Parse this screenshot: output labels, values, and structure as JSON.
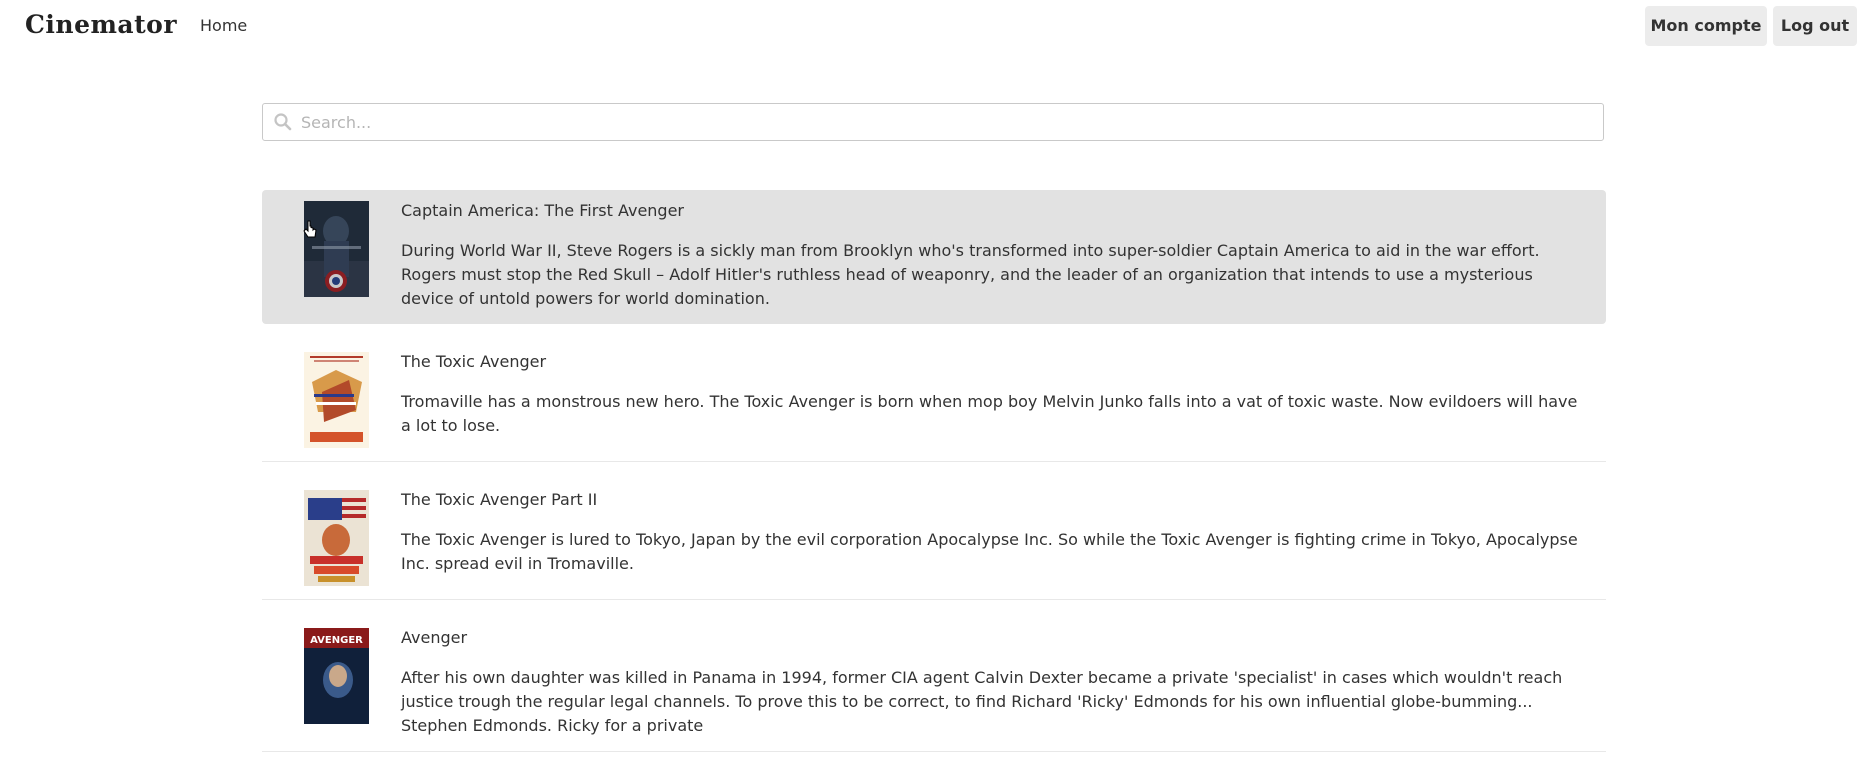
{
  "nav": {
    "brand": "Cinemator",
    "home": "Home",
    "account": "Mon compte",
    "logout": "Log out"
  },
  "search": {
    "placeholder": "Search...",
    "value": "",
    "icon": "search-icon"
  },
  "movies": [
    {
      "title": "Captain America: The First Avenger",
      "description": "During World War II, Steve Rogers is a sickly man from Brooklyn who's transformed into super-soldier Captain America to aid in the war effort. Rogers must stop the Red Skull – Adolf Hitler's ruthless head of weaponry, and the leader of an organization that intends to use a mysterious device of untold powers for world domination.",
      "active": true
    },
    {
      "title": "The Toxic Avenger",
      "description": "Tromaville has a monstrous new hero. The Toxic Avenger is born when mop boy Melvin Junko falls into a vat of toxic waste. Now evildoers will have a lot to lose.",
      "active": false
    },
    {
      "title": "The Toxic Avenger Part II",
      "description": "The Toxic Avenger is lured to Tokyo, Japan by the evil corporation Apocalypse Inc. So while the Toxic Avenger is fighting crime in Tokyo, Apocalypse Inc. spread evil in Tromaville.",
      "active": false
    },
    {
      "title": "Avenger",
      "description": "After his own daughter was killed in Panama in 1994, former CIA agent Calvin Dexter became a private 'specialist' in cases which wouldn't reach justice trough the regular legal channels. To prove this to be correct, to find Richard 'Ricky' Edmonds for his own influential globe-bumming... Stephen Edmonds. Ricky for a private",
      "active": false
    }
  ],
  "posters": {
    "poster_4_text": "AVENGER"
  },
  "colors": {
    "active_row": "#e2e2e2",
    "nav_button": "#ececec",
    "text": "#333333"
  }
}
